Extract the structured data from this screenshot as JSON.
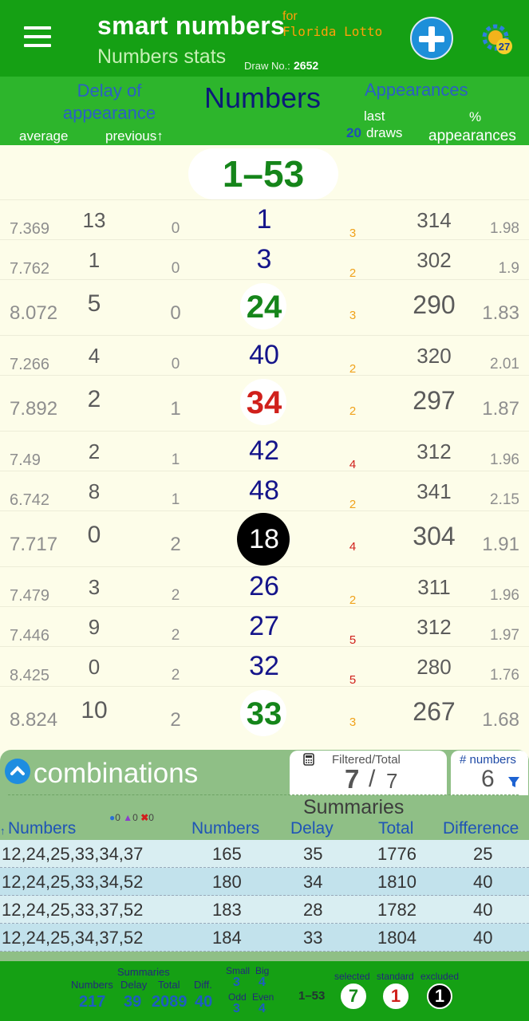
{
  "header": {
    "title": "smart numbers",
    "for_label": "for",
    "lottery": "Florida Lotto",
    "subtitle": "Numbers stats",
    "draw_label": "Draw No.:",
    "draw_no": "2652"
  },
  "columns": {
    "delay": "Delay of appearance",
    "average": "average",
    "previous": "previous↑",
    "numbers": "Numbers",
    "appearances": "Appearances",
    "last": "last",
    "last_count": "20",
    "draws": "draws",
    "pct_symbol": "%",
    "pct_label": "appearances"
  },
  "range": "1–53",
  "rows": [
    {
      "avg": "7.369",
      "delay": "13",
      "prev": "0",
      "num": "1",
      "last": "3",
      "app": "314",
      "pct": "1.98",
      "style": "normal"
    },
    {
      "avg": "7.762",
      "delay": "1",
      "prev": "0",
      "num": "3",
      "last": "2",
      "app": "302",
      "pct": "1.9",
      "style": "normal"
    },
    {
      "avg": "8.072",
      "delay": "5",
      "prev": "0",
      "num": "24",
      "last": "3",
      "app": "290",
      "pct": "1.83",
      "style": "green"
    },
    {
      "avg": "7.266",
      "delay": "4",
      "prev": "0",
      "num": "40",
      "last": "2",
      "app": "320",
      "pct": "2.01",
      "style": "normal"
    },
    {
      "avg": "7.892",
      "delay": "2",
      "prev": "1",
      "num": "34",
      "last": "2",
      "app": "297",
      "pct": "1.87",
      "style": "red"
    },
    {
      "avg": "7.49",
      "delay": "2",
      "prev": "1",
      "num": "42",
      "last": "4",
      "app": "312",
      "pct": "1.96",
      "style": "normal"
    },
    {
      "avg": "6.742",
      "delay": "8",
      "prev": "1",
      "num": "48",
      "last": "2",
      "app": "341",
      "pct": "2.15",
      "style": "normal"
    },
    {
      "avg": "7.717",
      "delay": "0",
      "prev": "2",
      "num": "18",
      "last": "4",
      "app": "304",
      "pct": "1.91",
      "style": "black"
    },
    {
      "avg": "7.479",
      "delay": "3",
      "prev": "2",
      "num": "26",
      "last": "2",
      "app": "311",
      "pct": "1.96",
      "style": "normal"
    },
    {
      "avg": "7.446",
      "delay": "9",
      "prev": "2",
      "num": "27",
      "last": "5",
      "app": "312",
      "pct": "1.97",
      "style": "normal"
    },
    {
      "avg": "8.425",
      "delay": "0",
      "prev": "2",
      "num": "32",
      "last": "5",
      "app": "280",
      "pct": "1.76",
      "style": "normal"
    },
    {
      "avg": "8.824",
      "delay": "10",
      "prev": "2",
      "num": "33",
      "last": "3",
      "app": "267",
      "pct": "1.68",
      "style": "green"
    }
  ],
  "combinations": {
    "title": "combinations",
    "filtered_label": "Filtered/Total",
    "filtered": "7",
    "separator": "/",
    "total": "7",
    "numbers_label": "# numbers",
    "numbers_count": "6",
    "summaries": "Summaries",
    "headers": {
      "numbers": "Numbers",
      "sum_numbers": "Numbers",
      "delay": "Delay",
      "total": "Total",
      "difference": "Difference"
    },
    "sort_arrow": "↑",
    "counts": {
      "drop": "0",
      "like": "0",
      "excluded": "0"
    },
    "rows": [
      {
        "set": "12,24,25,33,34,37",
        "numbers": "165",
        "delay": "35",
        "total": "1776",
        "diff": "25"
      },
      {
        "set": "12,24,25,33,34,52",
        "numbers": "180",
        "delay": "34",
        "total": "1810",
        "diff": "40"
      },
      {
        "set": "12,24,25,33,37,52",
        "numbers": "183",
        "delay": "28",
        "total": "1782",
        "diff": "40"
      },
      {
        "set": "12,24,25,34,37,52",
        "numbers": "184",
        "delay": "33",
        "total": "1804",
        "diff": "40"
      }
    ]
  },
  "footer": {
    "summaries": "Summaries",
    "labels": {
      "numbers": "Numbers",
      "delay": "Delay",
      "total": "Total",
      "diff": "Diff."
    },
    "values": {
      "numbers": "217",
      "delay": "39",
      "total": "2089",
      "diff": "40"
    },
    "small_label": "Small",
    "small": "3",
    "big_label": "Big",
    "big": "4",
    "odd_label": "Odd",
    "odd": "3",
    "even_label": "Even",
    "even": "4",
    "range": "1–53",
    "selected_label": "selected",
    "selected": "7",
    "standard_label": "standard",
    "standard": "1",
    "excluded_label": "excluded",
    "excluded": "1"
  },
  "colors": {
    "header_green": "#15a014",
    "number_blue": "#14148a",
    "green_num": "#15851a",
    "red_num": "#d0201b",
    "last_orange": "#f0a21b",
    "last_red": "#d0201b"
  }
}
